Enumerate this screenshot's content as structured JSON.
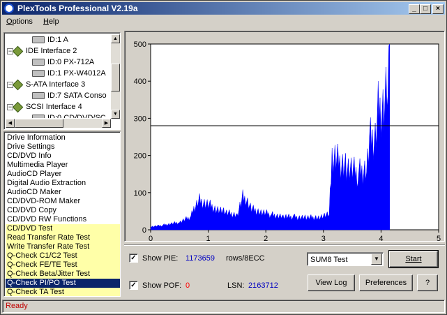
{
  "window": {
    "title": "PlexTools Professional V2.19a"
  },
  "menu": [
    {
      "label": "Options",
      "u": "O",
      "rest": "ptions"
    },
    {
      "label": "Help",
      "u": "H",
      "rest": "elp"
    }
  ],
  "tree": {
    "nodes": [
      {
        "kind": "drive",
        "label": "ID:1  A",
        "indent": 2
      },
      {
        "kind": "iface",
        "label": "IDE Interface 2",
        "indent": 1,
        "exp": "−"
      },
      {
        "kind": "drive",
        "label": "ID:0  PX-712A",
        "indent": 2
      },
      {
        "kind": "drive",
        "label": "ID:1  PX-W4012A",
        "indent": 2
      },
      {
        "kind": "iface",
        "label": "S-ATA Interface 3",
        "indent": 1,
        "exp": "−"
      },
      {
        "kind": "drive",
        "label": "ID:7  SATA Conso",
        "indent": 2
      },
      {
        "kind": "iface",
        "label": "SCSI Interface 4",
        "indent": 1,
        "exp": "−"
      },
      {
        "kind": "drive",
        "label": "ID:0  CD/DVD/SC",
        "indent": 2
      }
    ]
  },
  "functions": [
    {
      "label": "Drive Information",
      "style": ""
    },
    {
      "label": "Drive Settings",
      "style": ""
    },
    {
      "label": "CD/DVD Info",
      "style": ""
    },
    {
      "label": "Multimedia Player",
      "style": ""
    },
    {
      "label": "AudioCD Player",
      "style": ""
    },
    {
      "label": "Digital Audio Extraction",
      "style": ""
    },
    {
      "label": "AudioCD Maker",
      "style": ""
    },
    {
      "label": "CD/DVD-ROM Maker",
      "style": ""
    },
    {
      "label": "CD/DVD Copy",
      "style": ""
    },
    {
      "label": "CD/DVD RW Functions",
      "style": ""
    },
    {
      "label": "CD/DVD Test",
      "style": "hl"
    },
    {
      "label": "Read Transfer Rate Test",
      "style": "hl"
    },
    {
      "label": "Write Transfer Rate Test",
      "style": "hl"
    },
    {
      "label": "Q-Check C1/C2 Test",
      "style": "hl"
    },
    {
      "label": "Q-Check FE/TE Test",
      "style": "hl"
    },
    {
      "label": "Q-Check Beta/Jitter Test",
      "style": "hl"
    },
    {
      "label": "Q-Check PI/PO Test",
      "style": "sel"
    },
    {
      "label": "Q-Check TA Test",
      "style": "hl"
    }
  ],
  "controls": {
    "show_pie_label": "Show PIE:",
    "pie_count": "1173659",
    "pie_unit": "rows/8ECC",
    "show_pof_label": "Show POF:",
    "pof_count": "0",
    "lsn_label": "LSN:",
    "lsn_value": "2163712",
    "test_select": "SUM8 Test",
    "start_label": "Start",
    "viewlog_label": "View Log",
    "preferences_label": "Preferences",
    "help_label": "?"
  },
  "status": "Ready",
  "chart_data": {
    "type": "area",
    "xlim": [
      0,
      5
    ],
    "ylim": [
      0,
      500
    ],
    "x_ticks": [
      "0",
      "1",
      "2",
      "3",
      "4",
      "5"
    ],
    "y_ticks": [
      "0",
      "100",
      "200",
      "300",
      "400",
      "500"
    ],
    "threshold": 280,
    "series": [
      {
        "color": "#0000ff",
        "x": [
          0,
          0.2,
          0.5,
          0.7,
          0.75,
          0.85,
          0.95,
          1.1,
          1.3,
          1.5,
          1.6,
          1.65,
          1.75,
          1.9,
          2.1,
          2.3,
          2.5,
          2.7,
          2.9,
          3.1,
          3.15,
          3.2,
          3.4,
          3.6,
          3.75,
          3.8,
          3.9,
          3.95,
          4.05,
          4.12,
          4.15
        ],
        "y": [
          8,
          12,
          20,
          35,
          55,
          78,
          70,
          60,
          45,
          40,
          90,
          85,
          55,
          48,
          40,
          35,
          34,
          32,
          34,
          40,
          200,
          190,
          170,
          150,
          165,
          240,
          250,
          320,
          330,
          400,
          500
        ]
      }
    ]
  },
  "colors": {
    "plot_fill": "#0000ff",
    "count_text": "#0000c0",
    "pof_text": "#ff0000",
    "status_text": "#c00000",
    "selected_bg": "#0a246a",
    "highlight_bg": "#ffffa8"
  }
}
